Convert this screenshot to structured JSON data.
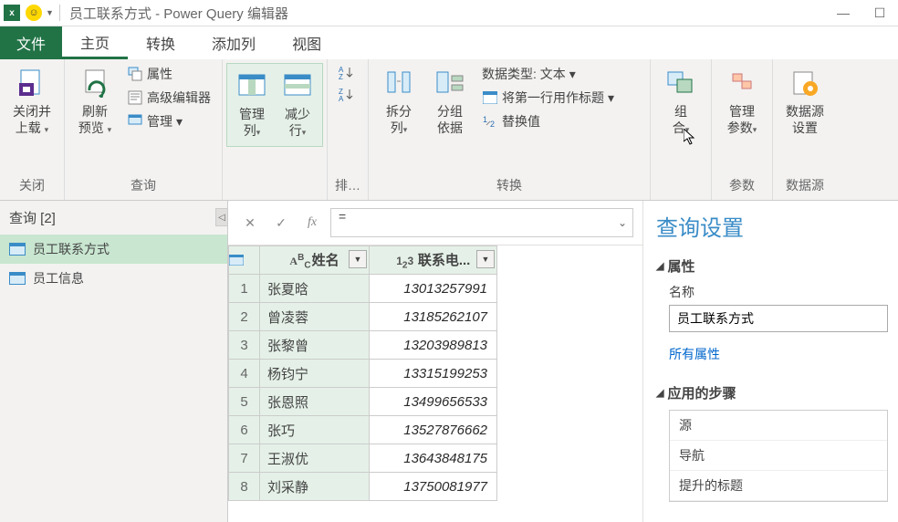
{
  "title": "员工联系方式 - Power Query 编辑器",
  "tabs": [
    "文件",
    "主页",
    "转换",
    "添加列",
    "视图"
  ],
  "activeTab": 1,
  "ribbon": {
    "close": {
      "label": "关闭并\n上载",
      "group": "关闭"
    },
    "refresh": {
      "label": "刷新\n预览"
    },
    "props": "属性",
    "advEditor": "高级编辑器",
    "manage": "管理",
    "queryGroup": "查询",
    "manageCols": "管理\n列",
    "reduceRows": "减少\n行",
    "sort": "排…",
    "splitCol": "拆分\n列",
    "groupBy": "分组\n依据",
    "dataType": "数据类型: 文本",
    "firstRowHeader": "将第一行用作标题",
    "replaceValues": "替换值",
    "transformGroup": "转换",
    "combine": "组\n合",
    "manageParams": "管理\n参数",
    "paramsGroup": "参数",
    "dataSource": "数据源\n设置",
    "dataSourceGroup": "数据源"
  },
  "queries": {
    "header": "查询 [2]",
    "items": [
      "员工联系方式",
      "员工信息"
    ],
    "selected": 0
  },
  "formula": "=",
  "columns": [
    {
      "type": "ABC",
      "name": "姓名"
    },
    {
      "type": "123",
      "name": "联系电..."
    }
  ],
  "rows": [
    {
      "n": 1,
      "name": "张夏晗",
      "phone": "13013257991"
    },
    {
      "n": 2,
      "name": "曾凌蓉",
      "phone": "13185262107"
    },
    {
      "n": 3,
      "name": "张黎曾",
      "phone": "13203989813"
    },
    {
      "n": 4,
      "name": "杨钧宁",
      "phone": "13315199253"
    },
    {
      "n": 5,
      "name": "张恩照",
      "phone": "13499656533"
    },
    {
      "n": 6,
      "name": "张巧",
      "phone": "13527876662"
    },
    {
      "n": 7,
      "name": "王淑优",
      "phone": "13643848175"
    },
    {
      "n": 8,
      "name": "刘采静",
      "phone": "13750081977"
    }
  ],
  "settings": {
    "title": "查询设置",
    "propsSection": "属性",
    "nameLabel": "名称",
    "nameValue": "员工联系方式",
    "allProps": "所有属性",
    "stepsSection": "应用的步骤",
    "steps": [
      "源",
      "导航",
      "提升的标题"
    ]
  }
}
